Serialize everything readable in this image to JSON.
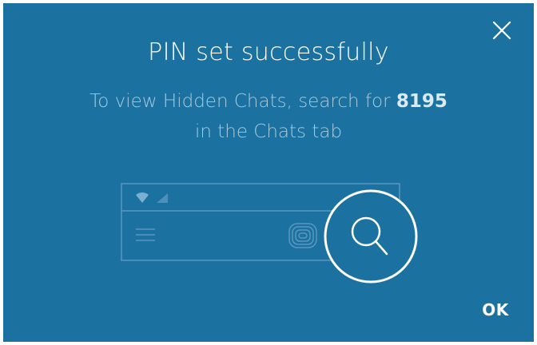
{
  "dialog": {
    "title": "PIN set successfully",
    "message_before": "To view Hidden Chats, search for ",
    "pin": "8195",
    "message_after": "in the Chats tab",
    "ok_label": "OK"
  },
  "icons": {
    "close": "close-icon",
    "search": "search-icon",
    "menu": "hamburger-menu-icon",
    "wifi": "wifi-icon",
    "signal": "signal-icon",
    "camera": "camera-icon"
  },
  "colors": {
    "background": "#1b71a0",
    "title": "#ffffff",
    "message": "#a7cadd",
    "pin": "#dbe9f1",
    "illustration_line": "#5b98bf"
  }
}
